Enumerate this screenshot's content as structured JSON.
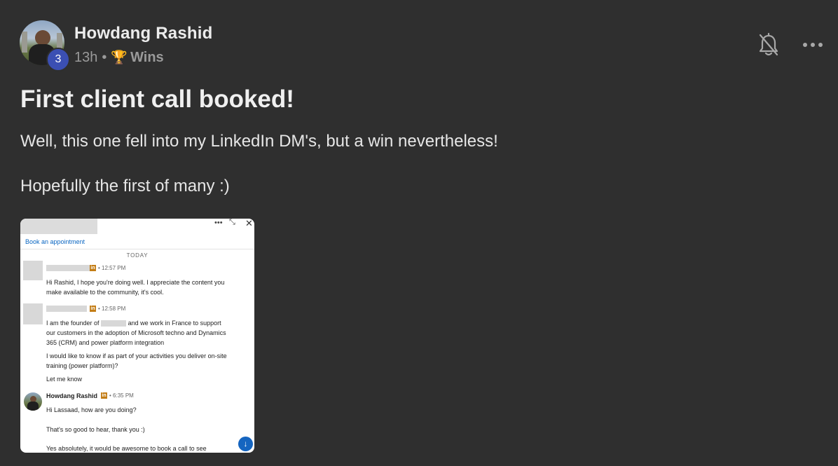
{
  "author": {
    "name": "Howdang Rashid",
    "level": "3"
  },
  "meta": {
    "time": "13h",
    "separator": "•",
    "category_icon": "trophy-icon",
    "category": "Wins"
  },
  "actions": {
    "bell_icon": "bell-off-icon",
    "more_icon": "more-horizontal-icon"
  },
  "post": {
    "title": "First client call booked!",
    "body_line1": "Well, this one fell into my LinkedIn DM's, but a win nevertheless!",
    "body_line2": "Hopefully the first of many :)"
  },
  "attachment": {
    "book_link": "Book an appointment",
    "day_label": "TODAY",
    "messages": [
      {
        "time": "• 12:57 PM",
        "text": "Hi Rashid, I hope you're doing well. I appreciate the content you make available to the community, it's cool."
      },
      {
        "time": "• 12:58 PM",
        "text_a1": "I am the founder of",
        "text_a2": "and we work in France to support our customers in the adoption of Microsoft techno and Dynamics 365 (CRM) and power platform integration",
        "text_b": "I would like to know if as part of your activities you deliver on-site training (power platform)?",
        "text_c": "Let me know"
      },
      {
        "name": "Howdang Rashid",
        "time": "• 6:35 PM",
        "text_a": "Hi Lassaad, how are you doing?",
        "text_b": "That's so good to hear, thank you :)",
        "text_c": "Yes absolutely, it would be awesome to book a call to see"
      }
    ],
    "linkedin_badge": "in",
    "scroll_icon": "arrow-down-icon",
    "brand_color": "#0a66c2"
  },
  "colors": {
    "background": "#2f2f2f",
    "level_badge": "#3b4fb3"
  }
}
